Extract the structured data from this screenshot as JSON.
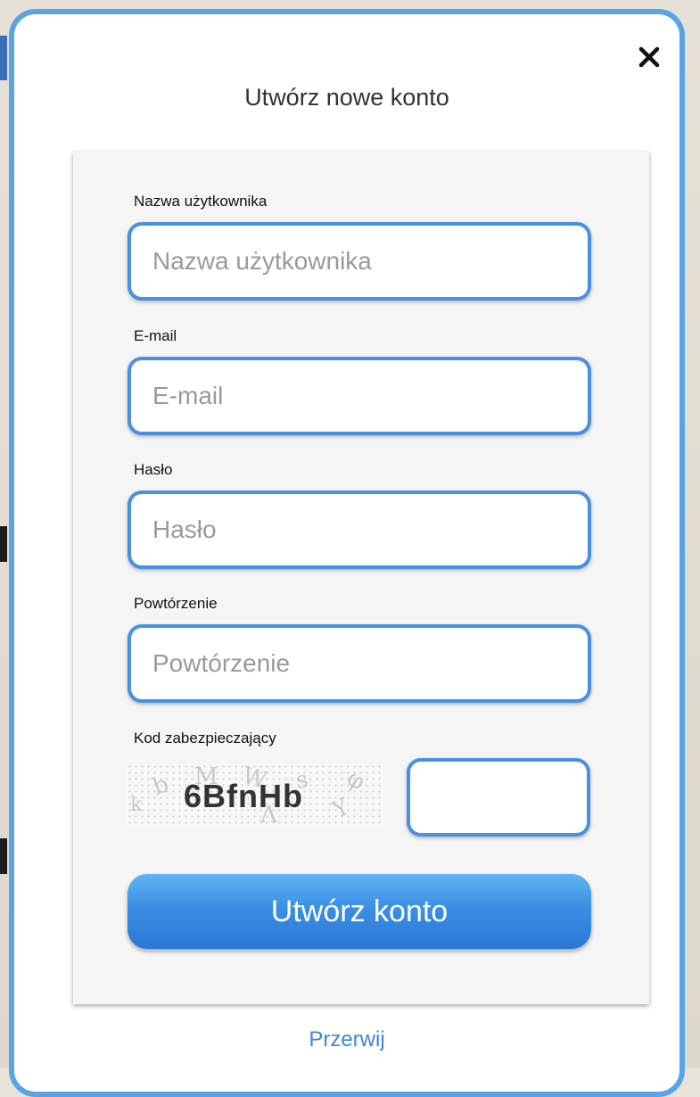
{
  "dialog": {
    "title": "Utwórz nowe konto",
    "close_icon": "close-icon"
  },
  "form": {
    "fields": [
      {
        "label": "Nazwa użytkownika",
        "placeholder": "Nazwa użytkownika",
        "value": ""
      },
      {
        "label": "E-mail",
        "placeholder": "E-mail",
        "value": ""
      },
      {
        "label": "Hasło",
        "placeholder": "Hasło",
        "value": ""
      },
      {
        "label": "Powtórzenie",
        "placeholder": "Powtórzenie",
        "value": ""
      }
    ],
    "captcha": {
      "label": "Kod zabezpieczający",
      "code": "6BfnHb",
      "value": ""
    },
    "submit_label": "Utwórz konto"
  },
  "footer": {
    "dismiss_label": "Przerwij"
  },
  "colors": {
    "accent": "#4a90e2",
    "button_top": "#5fb4f5",
    "button_bottom": "#2a77d6",
    "link": "#3f86d6"
  }
}
